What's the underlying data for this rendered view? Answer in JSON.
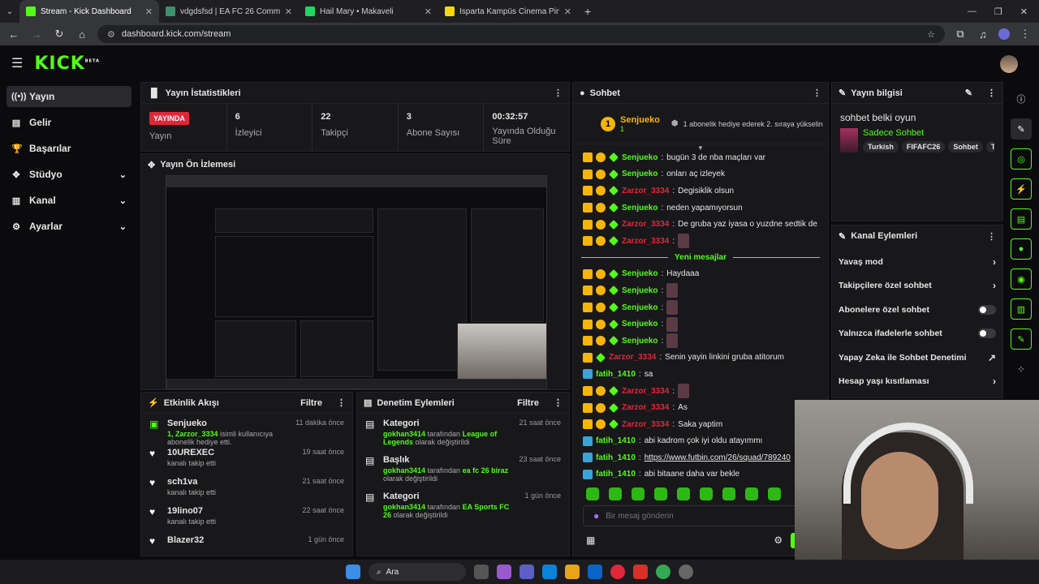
{
  "browser": {
    "tabs": [
      {
        "title": "Stream - Kick Dashboard",
        "color": "#53fc18",
        "active": true
      },
      {
        "title": "vdgdsfsd | EA FC 26 Communit",
        "color": "#3d8f6d",
        "active": false
      },
      {
        "title": "Hail Mary • Makaveli",
        "color": "#1ed760",
        "active": false
      },
      {
        "title": "Isparta Kampüs Cinema Pink | M",
        "color": "#f5d90a",
        "active": false
      }
    ],
    "url": "dashboard.kick.com/stream"
  },
  "sidebar": {
    "items": [
      {
        "label": "Yayın",
        "icon": "broadcast-icon"
      },
      {
        "label": "Gelir",
        "icon": "revenue-icon"
      },
      {
        "label": "Başarılar",
        "icon": "trophy-icon"
      },
      {
        "label": "Stüdyo",
        "icon": "studio-icon"
      },
      {
        "label": "Kanal",
        "icon": "channel-icon"
      },
      {
        "label": "Ayarlar",
        "icon": "gear-icon"
      }
    ]
  },
  "stats": {
    "title": "Yayın İstatistikleri",
    "live_badge": "YAYINDA",
    "live_label": "Yayın",
    "viewers": "6",
    "viewers_label": "İzleyici",
    "followers": "22",
    "followers_label": "Takipçi",
    "subs": "3",
    "subs_label": "Abone Sayısı",
    "uptime": "00:32:57",
    "uptime_label": "Yayında Olduğu Süre"
  },
  "preview": {
    "title": "Yayın Ön İzlemesi"
  },
  "activity": {
    "title": "Etkinlik Akışı",
    "filter": "Filtre",
    "items": [
      {
        "name": "Senjueko",
        "sub_user": "1, Zarzor_3334",
        "sub": " isimli kullanıcıya abonelik hediye etti.",
        "time": "11 dakika önce"
      },
      {
        "name": "10UREXEC",
        "sub_user": "",
        "sub": "kanalı takip etti",
        "time": "19 saat önce"
      },
      {
        "name": "sch1va",
        "sub_user": "",
        "sub": "kanalı takip etti",
        "time": "21 saat önce"
      },
      {
        "name": "19lino07",
        "sub_user": "",
        "sub": "kanalı takip etti",
        "time": "22 saat önce"
      },
      {
        "name": "Blazer32",
        "sub_user": "",
        "sub": "",
        "time": "1 gün önce"
      }
    ]
  },
  "moderation": {
    "title": "Denetim Eylemleri",
    "filter": "Filtre",
    "items": [
      {
        "title": "Kategori",
        "user": "gokhan3414",
        "mid": " tarafından ",
        "val": "League of Legends",
        "end": " olarak değiştirildi",
        "time": "21 saat önce"
      },
      {
        "title": "Başlık",
        "user": "gokhan3414",
        "mid": " tarafından ",
        "val": "ea fc 26 biraz",
        "end": " olarak değiştirildi",
        "time": "23 saat önce"
      },
      {
        "title": "Kategori",
        "user": "gokhan3414",
        "mid": " tarafından ",
        "val": "EA Sports FC 26",
        "end": " olarak değiştirildi",
        "time": "1 gün önce"
      }
    ]
  },
  "chat": {
    "title": "Sohbet",
    "top_user": "Senjueko",
    "top_rank": "1",
    "top_count": "1",
    "gift_note": "1 abonelik hediye ederek 2. sıraya yükselin",
    "new_messages": "Yeni mesajlar",
    "messages_before": [
      {
        "user": "Senjueko",
        "color": "green",
        "badges": [
          "crown",
          "one",
          "gift"
        ],
        "text": "bugün 3 de nba maçları var"
      },
      {
        "user": "Senjueko",
        "color": "green",
        "badges": [
          "crown",
          "one",
          "gift"
        ],
        "text": "onları aç izleyek"
      },
      {
        "user": "Zarzor_3334",
        "color": "red",
        "badges": [
          "crown",
          "one",
          "gift"
        ],
        "text": "Degisiklik olsun"
      },
      {
        "user": "Senjueko",
        "color": "green",
        "badges": [
          "crown",
          "one",
          "gift"
        ],
        "text": "neden yapamıyorsun"
      },
      {
        "user": "Zarzor_3334",
        "color": "red",
        "badges": [
          "crown",
          "one",
          "gift"
        ],
        "text": "De gruba yaz iyasa o yuzdne sedtik de"
      },
      {
        "user": "Zarzor_3334",
        "color": "red",
        "badges": [
          "crown",
          "one",
          "gift"
        ],
        "text": ""
      }
    ],
    "messages_after": [
      {
        "user": "Senjueko",
        "color": "green",
        "badges": [
          "crown",
          "one",
          "gift"
        ],
        "text": "Haydaaa"
      },
      {
        "user": "Senjueko",
        "color": "green",
        "badges": [
          "crown",
          "one",
          "gift"
        ],
        "text": ""
      },
      {
        "user": "Senjueko",
        "color": "green",
        "badges": [
          "crown",
          "one",
          "gift"
        ],
        "text": ""
      },
      {
        "user": "Senjueko",
        "color": "green",
        "badges": [
          "crown",
          "one",
          "gift"
        ],
        "text": ""
      },
      {
        "user": "Senjueko",
        "color": "green",
        "badges": [
          "crown",
          "one",
          "gift"
        ],
        "text": ""
      },
      {
        "user": "Zarzor_3334",
        "color": "red",
        "badges": [
          "crown",
          "gift"
        ],
        "text": "Senin yayin linkini gruba atitorum"
      },
      {
        "user": "fatih_1410",
        "color": "green",
        "badges": [
          "tw"
        ],
        "text": "sa"
      },
      {
        "user": "Zarzor_3334",
        "color": "red",
        "badges": [
          "crown",
          "one",
          "gift"
        ],
        "text": ""
      },
      {
        "user": "Zarzor_3334",
        "color": "red",
        "badges": [
          "crown",
          "one",
          "gift"
        ],
        "text": "As"
      },
      {
        "user": "Zarzor_3334",
        "color": "red",
        "badges": [
          "crown",
          "one",
          "gift"
        ],
        "text": "Saka yaptim"
      },
      {
        "user": "fatih_1410",
        "color": "green",
        "badges": [
          "tw"
        ],
        "text": "abi kadrom çok iyi oldu atayımmı"
      },
      {
        "user": "fatih_1410",
        "color": "green",
        "badges": [
          "tw"
        ],
        "text": "https://www.futbin.com/26/squad/789240"
      },
      {
        "user": "fatih_1410",
        "color": "green",
        "badges": [
          "tw"
        ],
        "text": "abi bitaane daha var bekle"
      }
    ],
    "input_placeholder": "Bir mesaj gönderin",
    "send": "Gö"
  },
  "stream_info": {
    "title": "Yayın bilgisi",
    "stream_title": "sohbet belki oyun",
    "category": "Sadece Sohbet",
    "tags": [
      "Turkish",
      "FIFAFC26",
      "Sohbet",
      "Türk"
    ]
  },
  "channel_actions": {
    "title": "Kanal Eylemleri",
    "items": [
      {
        "label": "Yavaş mod",
        "control": "chevron"
      },
      {
        "label": "Takipçilere özel sohbet",
        "control": "chevron"
      },
      {
        "label": "Abonelere özel sohbet",
        "control": "toggle"
      },
      {
        "label": "Yalnızca ifadelerle sohbet",
        "control": "toggle"
      },
      {
        "label": "Yapay Zeka ile Sohbet Denetimi",
        "control": "external"
      },
      {
        "label": "Hesap yaşı kısıtlaması",
        "control": "chevron"
      }
    ]
  },
  "taskbar": {
    "search": "Ara"
  }
}
